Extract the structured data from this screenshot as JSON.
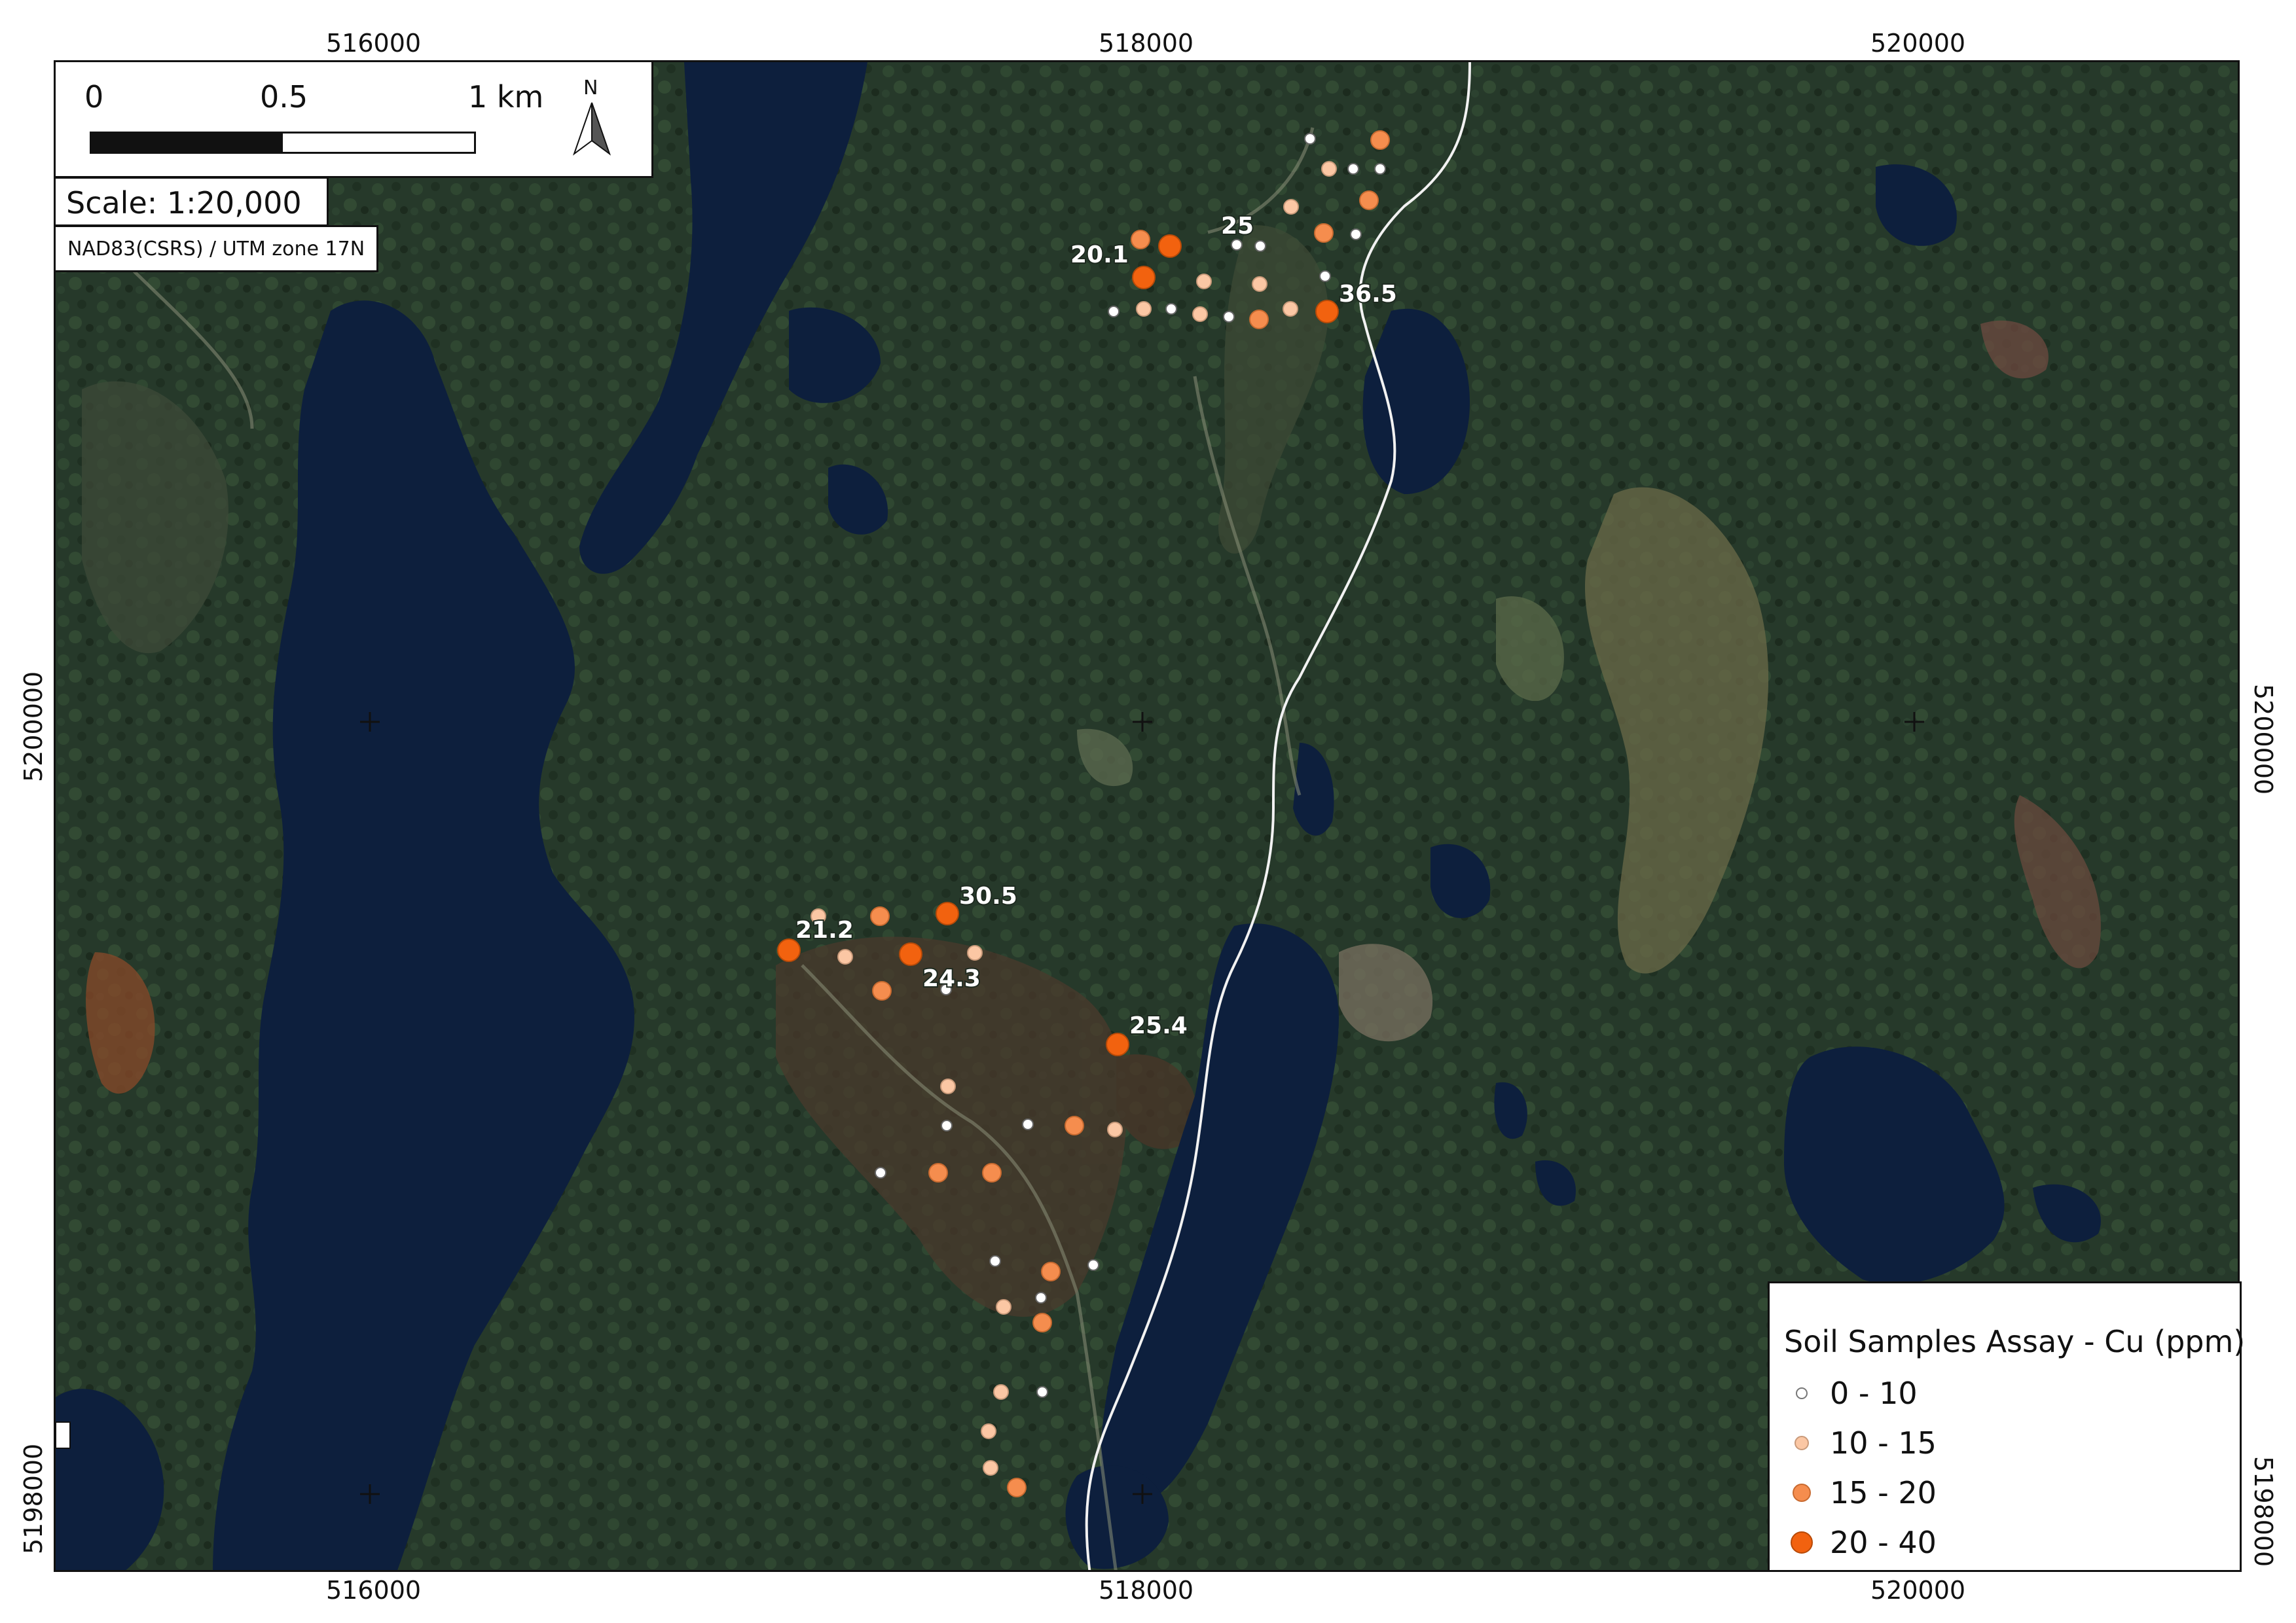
{
  "grid_labels": {
    "top": [
      "516000",
      "518000",
      "520000"
    ],
    "bottom": [
      "516000",
      "518000",
      "520000"
    ],
    "left": [
      "5200000",
      "5198000"
    ],
    "right": [
      "5200000",
      "5198000"
    ]
  },
  "scale_bar": {
    "tick_0": "0",
    "tick_mid": "0.5",
    "tick_end": "1 km",
    "north": "N"
  },
  "scale_text": "Scale: 1:20,000",
  "crs_text": "NAD83(CSRS) / UTM zone 17N",
  "legend": {
    "title": "Soil Samples Assay - Cu (ppm)",
    "classes": [
      {
        "label": "0 - 10",
        "color": "#ffffff"
      },
      {
        "label": "10 - 15",
        "color": "#fbc7a4"
      },
      {
        "label": "15 - 20",
        "color": "#f58d4e"
      },
      {
        "label": "20 - 40",
        "color": "#f2620f"
      }
    ]
  },
  "samples_labeled": [
    {
      "label": "25",
      "cls": 3
    },
    {
      "label": "20.1",
      "cls": 3
    },
    {
      "label": "36.5",
      "cls": 3
    },
    {
      "label": "30.5",
      "cls": 3
    },
    {
      "label": "21.2",
      "cls": 3
    },
    {
      "label": "24.3",
      "cls": 3
    },
    {
      "label": "25.4",
      "cls": 3
    }
  ],
  "colors": {
    "forest": "#27392a",
    "water": "#0d1f3d",
    "road": "#e8e8e8"
  }
}
